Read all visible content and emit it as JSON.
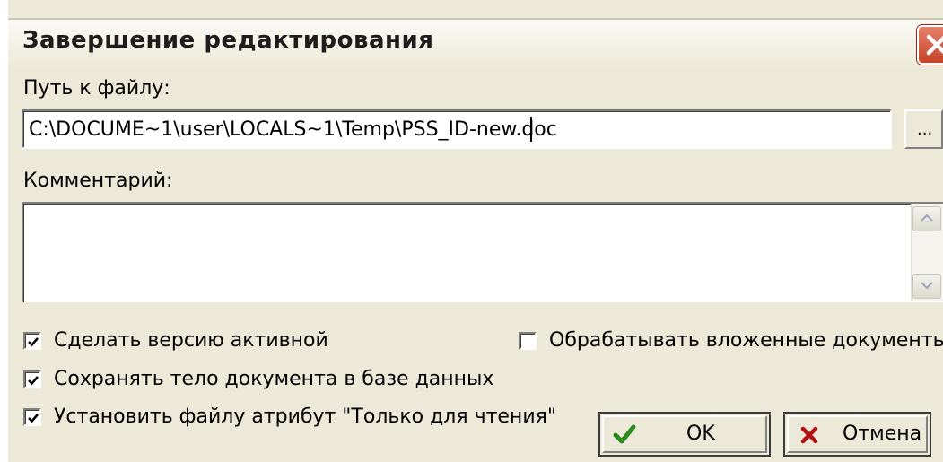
{
  "window": {
    "title": "Завершение редактирования"
  },
  "fields": {
    "path_label": "Путь к файлу:",
    "path_value": "C:\\DOCUME~1\\user\\LOCALS~1\\Temp\\PSS_ID-new.doc",
    "browse_label": "...",
    "comment_label": "Комментарий:",
    "comment_value": ""
  },
  "options": {
    "make_active": {
      "label": "Сделать версию активной",
      "checked": true
    },
    "save_body": {
      "label": "Сохранять тело документа в базе данных",
      "checked": true
    },
    "read_only": {
      "label": "Установить файлу атрибут \"Только для чтения\"",
      "checked": true
    },
    "process_nested": {
      "label": "Обрабатывать вложенные документы",
      "checked": false
    }
  },
  "buttons": {
    "ok": "OK",
    "cancel": "Отмена"
  },
  "colors": {
    "check_green": "#2d8a1e",
    "cancel_red": "#b01010",
    "close_red": "#c44429"
  },
  "icons": {
    "close": "close-icon",
    "ok": "checkmark-icon",
    "cancel": "cross-icon",
    "scroll_up": "arrow-up-icon",
    "scroll_down": "arrow-down-icon"
  }
}
